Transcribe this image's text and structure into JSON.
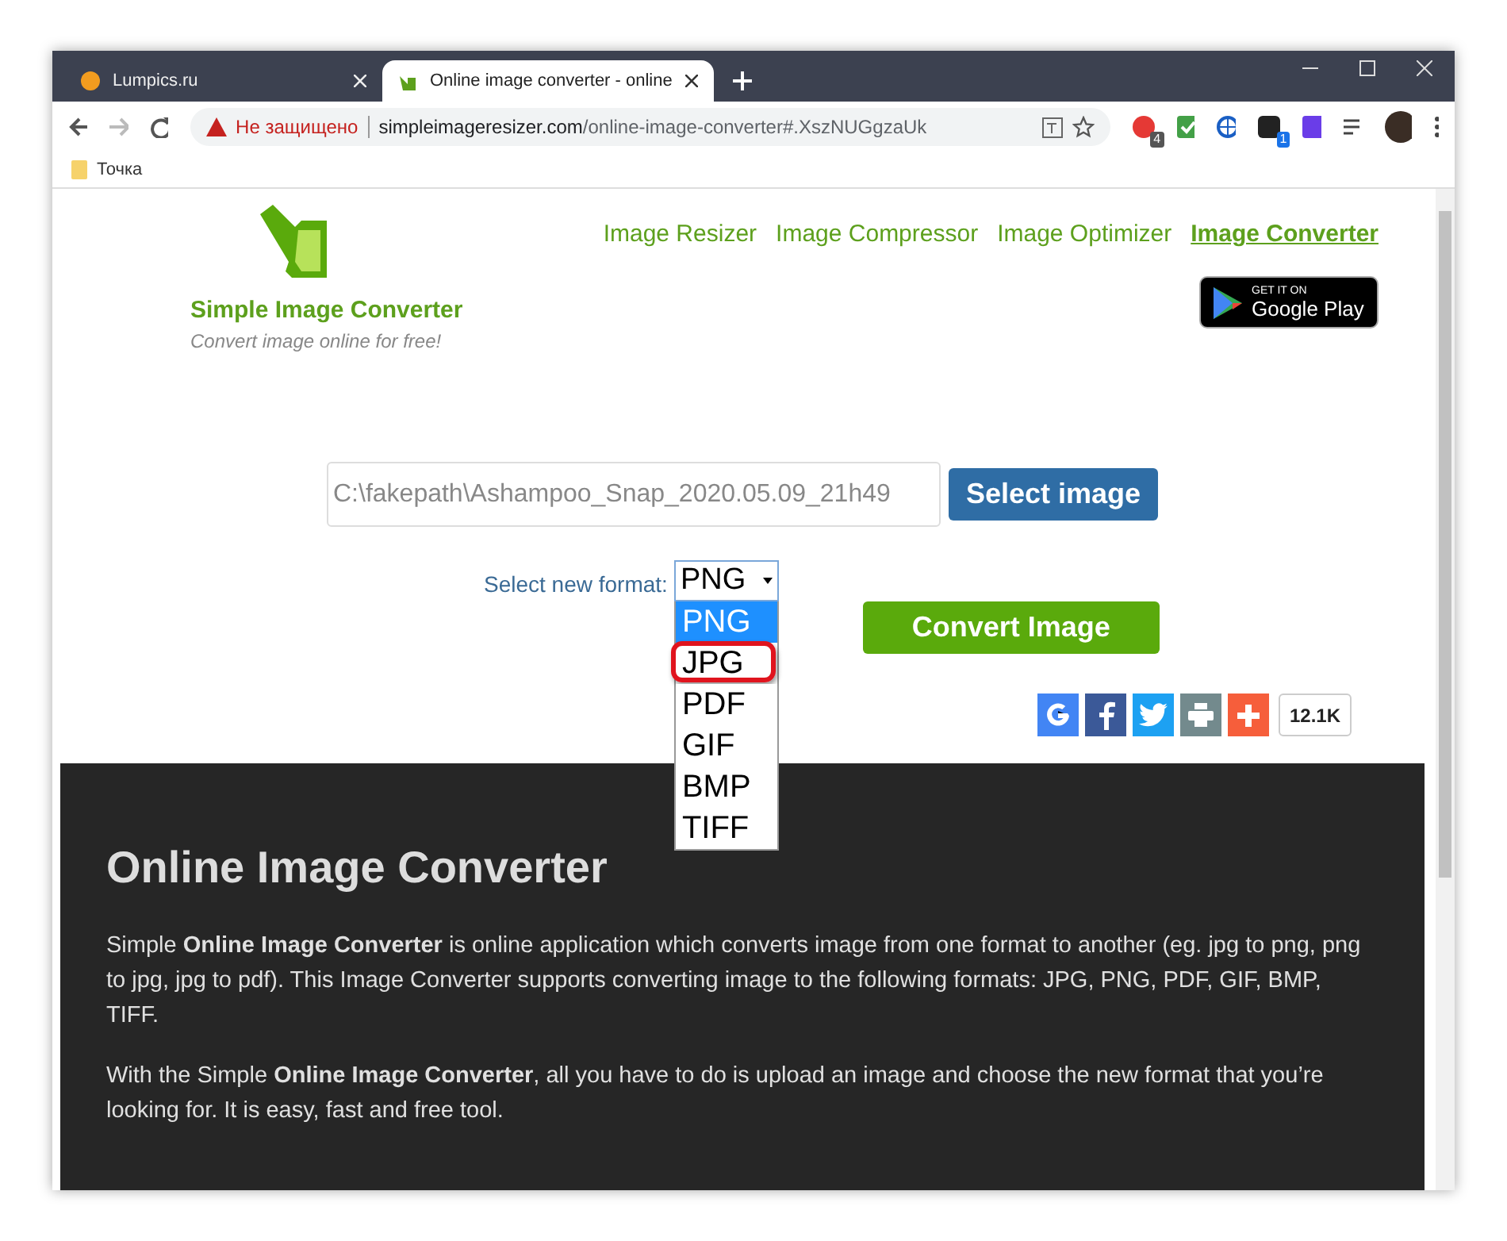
{
  "browser": {
    "tabs": [
      {
        "title": "Lumpics.ru",
        "selected": false
      },
      {
        "title": "Online image converter - online",
        "selected": true
      }
    ],
    "security_label": "Не защищено",
    "url_host": "simpleimageresizer.com",
    "url_path": "/online-image-converter#.XszNUGgzaUk",
    "extension_badges": [
      "4",
      "1"
    ],
    "bookmarks": [
      "Точка"
    ]
  },
  "site": {
    "brand": "Simple Image Converter",
    "tagline": "Convert image online for free!",
    "nav": [
      {
        "label": "Image Resizer",
        "selected": false
      },
      {
        "label": "Image Compressor",
        "selected": false
      },
      {
        "label": "Image Optimizer",
        "selected": false
      },
      {
        "label": "Image Converter",
        "selected": true
      }
    ],
    "store_badge": {
      "small": "GET IT ON",
      "big": "Google Play"
    },
    "file_value": "C:\\fakepath\\Ashampoo_Snap_2020.05.09_21h49",
    "select_button": "Select image",
    "format_label": "Select new format:",
    "format_value": "PNG",
    "format_options": [
      {
        "label": "PNG",
        "selected": true,
        "circled": false
      },
      {
        "label": "JPG",
        "selected": false,
        "circled": true
      },
      {
        "label": "PDF",
        "selected": false,
        "circled": false
      },
      {
        "label": "GIF",
        "selected": false,
        "circled": false
      },
      {
        "label": "BMP",
        "selected": false,
        "circled": false
      },
      {
        "label": "TIFF",
        "selected": false,
        "circled": false
      }
    ],
    "convert_button": "Convert Image",
    "share": [
      {
        "kind": "google",
        "color": "#4285f4"
      },
      {
        "kind": "facebook",
        "color": "#3b5998"
      },
      {
        "kind": "twitter",
        "color": "#1da1f2"
      },
      {
        "kind": "print",
        "color": "#738a8d"
      },
      {
        "kind": "more",
        "color": "#f65e3b"
      }
    ],
    "share_count": "12.1K",
    "article": {
      "heading": "Online Image Converter",
      "paragraphs": [
        "Simple **Online Image Converter** is online application which converts image from one format to another (eg. jpg to png, png to jpg, jpg to pdf). This Image Converter supports converting image to the following formats: JPG, PNG, PDF, GIF, BMP, TIFF.",
        "With the Simple **Online Image Converter**, all you have to do is upload an image and choose the new format that you’re looking for. It is easy, fast and free tool."
      ]
    }
  }
}
